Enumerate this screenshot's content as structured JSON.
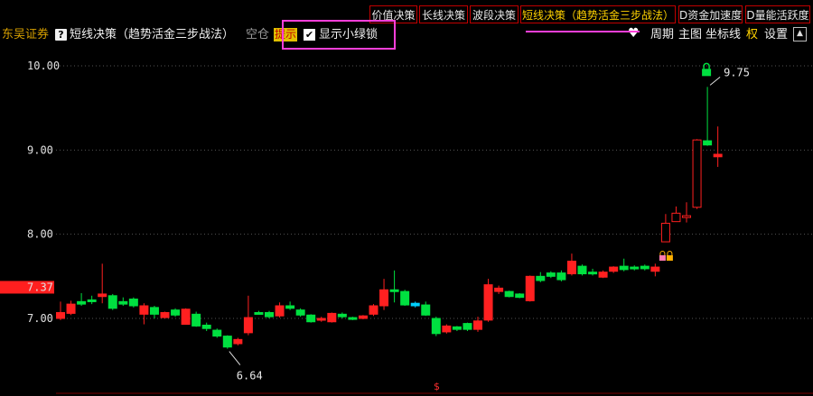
{
  "tabs": [
    {
      "label": "价值决策",
      "active": false
    },
    {
      "label": "长线决策",
      "active": false
    },
    {
      "label": "波段决策",
      "active": false
    },
    {
      "label": "短线决策（趋势活金三步战法）",
      "active": true
    },
    {
      "label": "D资金加速度",
      "active": false
    },
    {
      "label": "D量能活跃度",
      "active": false
    }
  ],
  "info": {
    "broker": "东吴证券",
    "help_icon": "?",
    "indicator": "短线决策（趋势活金三步战法）",
    "position": "空仓",
    "hint": "提示",
    "checkbox_mark": "✔",
    "checkbox_label": "显示小绿锁"
  },
  "toolbar": {
    "heart_icon": "♥",
    "period": "周期",
    "main_chart": "主图",
    "axis": "坐标线",
    "rights": "权",
    "settings": "设置",
    "up_icon": "▲"
  },
  "colors": {
    "up": "#ff2020",
    "down": "#00e040",
    "cyan": "#00d0ff",
    "current_price_bg": "#ff1f1f",
    "highlight": "#ff3fd9"
  },
  "chart_data": {
    "type": "candlestick",
    "ylim": [
      6.53,
      10.7
    ],
    "y_ticks": [
      "10.00",
      "9.00",
      "8.00",
      "7.00"
    ],
    "y_tick_values": [
      10.0,
      9.0,
      8.0,
      7.0
    ],
    "current_price_label": "7.37",
    "current_price": 7.37,
    "max_label": "9.75",
    "min_label": "6.64",
    "bottom_marker": "$",
    "lock_icons": [
      "lock-icon-green",
      "lock-icon-orange"
    ],
    "candles": [
      {
        "o": 7.0,
        "c": 7.07,
        "h": 7.2,
        "l": 6.98,
        "color": "up"
      },
      {
        "o": 7.06,
        "c": 7.17,
        "h": 7.21,
        "l": 7.04,
        "color": "up"
      },
      {
        "o": 7.2,
        "c": 7.17,
        "h": 7.3,
        "l": 7.15,
        "color": "down"
      },
      {
        "o": 7.22,
        "c": 7.21,
        "h": 7.27,
        "l": 7.17,
        "color": "down"
      },
      {
        "o": 7.26,
        "c": 7.29,
        "h": 7.65,
        "l": 7.18,
        "color": "up"
      },
      {
        "o": 7.27,
        "c": 7.12,
        "h": 7.29,
        "l": 7.1,
        "color": "down"
      },
      {
        "o": 7.2,
        "c": 7.17,
        "h": 7.25,
        "l": 7.15,
        "color": "down"
      },
      {
        "o": 7.23,
        "c": 7.15,
        "h": 7.25,
        "l": 7.13,
        "color": "down"
      },
      {
        "o": 7.05,
        "c": 7.15,
        "h": 7.18,
        "l": 6.93,
        "color": "up"
      },
      {
        "o": 7.13,
        "c": 7.05,
        "h": 7.15,
        "l": 7.0,
        "color": "down"
      },
      {
        "o": 7.01,
        "c": 7.07,
        "h": 7.08,
        "l": 7.0,
        "color": "up"
      },
      {
        "o": 7.1,
        "c": 7.04,
        "h": 7.12,
        "l": 7.02,
        "color": "down"
      },
      {
        "o": 6.93,
        "c": 7.11,
        "h": 7.12,
        "l": 6.93,
        "color": "up"
      },
      {
        "o": 7.05,
        "c": 6.91,
        "h": 7.08,
        "l": 6.9,
        "color": "down"
      },
      {
        "o": 6.92,
        "c": 6.88,
        "h": 6.95,
        "l": 6.85,
        "color": "down"
      },
      {
        "o": 6.86,
        "c": 6.79,
        "h": 6.88,
        "l": 6.77,
        "color": "down"
      },
      {
        "o": 6.79,
        "c": 6.66,
        "h": 6.8,
        "l": 6.64,
        "color": "down"
      },
      {
        "o": 6.7,
        "c": 6.75,
        "h": 6.77,
        "l": 6.68,
        "color": "up"
      },
      {
        "o": 6.83,
        "c": 7.01,
        "h": 7.27,
        "l": 6.8,
        "color": "up"
      },
      {
        "o": 7.07,
        "c": 7.07,
        "h": 7.09,
        "l": 7.05,
        "color": "down"
      },
      {
        "o": 7.07,
        "c": 7.02,
        "h": 7.09,
        "l": 7.0,
        "color": "down"
      },
      {
        "o": 7.03,
        "c": 7.15,
        "h": 7.19,
        "l": 7.01,
        "color": "up"
      },
      {
        "o": 7.15,
        "c": 7.12,
        "h": 7.2,
        "l": 7.1,
        "color": "down"
      },
      {
        "o": 7.1,
        "c": 7.04,
        "h": 7.12,
        "l": 7.02,
        "color": "down"
      },
      {
        "o": 7.04,
        "c": 6.96,
        "h": 7.05,
        "l": 6.95,
        "color": "down"
      },
      {
        "o": 6.98,
        "c": 7.0,
        "h": 7.02,
        "l": 6.96,
        "color": "up"
      },
      {
        "o": 6.96,
        "c": 7.06,
        "h": 7.07,
        "l": 6.95,
        "color": "up"
      },
      {
        "o": 7.05,
        "c": 7.02,
        "h": 7.07,
        "l": 7.0,
        "color": "down"
      },
      {
        "o": 7.01,
        "c": 7.0,
        "h": 7.02,
        "l": 6.98,
        "color": "down"
      },
      {
        "o": 7.0,
        "c": 7.03,
        "h": 7.04,
        "l": 6.99,
        "color": "up"
      },
      {
        "o": 7.05,
        "c": 7.15,
        "h": 7.17,
        "l": 7.03,
        "color": "up"
      },
      {
        "o": 7.15,
        "c": 7.34,
        "h": 7.47,
        "l": 7.1,
        "color": "up"
      },
      {
        "o": 7.34,
        "c": 7.32,
        "h": 7.57,
        "l": 7.19,
        "color": "down"
      },
      {
        "o": 7.32,
        "c": 7.16,
        "h": 7.34,
        "l": 7.15,
        "color": "down"
      },
      {
        "o": 7.18,
        "c": 7.15,
        "h": 7.2,
        "l": 7.13,
        "color": "cyan"
      },
      {
        "o": 7.16,
        "c": 7.04,
        "h": 7.2,
        "l": 7.03,
        "color": "down"
      },
      {
        "o": 7.0,
        "c": 6.82,
        "h": 7.02,
        "l": 6.79,
        "color": "down"
      },
      {
        "o": 6.84,
        "c": 6.91,
        "h": 6.93,
        "l": 6.82,
        "color": "up"
      },
      {
        "o": 6.9,
        "c": 6.87,
        "h": 6.91,
        "l": 6.85,
        "color": "down"
      },
      {
        "o": 6.87,
        "c": 6.94,
        "h": 6.95,
        "l": 6.85,
        "color": "down"
      },
      {
        "o": 6.87,
        "c": 6.97,
        "h": 7.02,
        "l": 6.84,
        "color": "up"
      },
      {
        "o": 6.98,
        "c": 7.4,
        "h": 7.47,
        "l": 6.96,
        "color": "up"
      },
      {
        "o": 7.32,
        "c": 7.36,
        "h": 7.39,
        "l": 7.29,
        "color": "up"
      },
      {
        "o": 7.32,
        "c": 7.26,
        "h": 7.33,
        "l": 7.25,
        "color": "down"
      },
      {
        "o": 7.25,
        "c": 7.29,
        "h": 7.3,
        "l": 7.24,
        "color": "down"
      },
      {
        "o": 7.21,
        "c": 7.5,
        "h": 7.51,
        "l": 7.2,
        "color": "up"
      },
      {
        "o": 7.5,
        "c": 7.45,
        "h": 7.55,
        "l": 7.43,
        "color": "down"
      },
      {
        "o": 7.54,
        "c": 7.5,
        "h": 7.56,
        "l": 7.48,
        "color": "down"
      },
      {
        "o": 7.54,
        "c": 7.46,
        "h": 7.57,
        "l": 7.44,
        "color": "down"
      },
      {
        "o": 7.53,
        "c": 7.68,
        "h": 7.77,
        "l": 7.51,
        "color": "up"
      },
      {
        "o": 7.62,
        "c": 7.53,
        "h": 7.64,
        "l": 7.51,
        "color": "down"
      },
      {
        "o": 7.54,
        "c": 7.55,
        "h": 7.59,
        "l": 7.51,
        "color": "down"
      },
      {
        "o": 7.49,
        "c": 7.55,
        "h": 7.57,
        "l": 7.48,
        "color": "up"
      },
      {
        "o": 7.56,
        "c": 7.61,
        "h": 7.62,
        "l": 7.54,
        "color": "up"
      },
      {
        "o": 7.62,
        "c": 7.58,
        "h": 7.71,
        "l": 7.56,
        "color": "down"
      },
      {
        "o": 7.59,
        "c": 7.61,
        "h": 7.63,
        "l": 7.57,
        "color": "down"
      },
      {
        "o": 7.59,
        "c": 7.62,
        "h": 7.64,
        "l": 7.57,
        "color": "down"
      },
      {
        "o": 7.56,
        "c": 7.61,
        "h": 7.65,
        "l": 7.5,
        "color": "up"
      },
      {
        "o": 8.13,
        "c": 7.91,
        "h": 8.24,
        "l": 7.95,
        "color": "up"
      },
      {
        "o": 8.15,
        "c": 8.25,
        "h": 8.33,
        "l": 8.15,
        "color": "up"
      },
      {
        "o": 8.21,
        "c": 8.22,
        "h": 8.38,
        "l": 8.14,
        "color": "up"
      },
      {
        "o": 8.32,
        "c": 9.12,
        "h": 9.13,
        "l": 8.3,
        "color": "up"
      },
      {
        "o": 9.06,
        "c": 9.11,
        "h": 9.75,
        "l": 9.05,
        "color": "down"
      },
      {
        "o": 8.92,
        "c": 8.95,
        "h": 9.28,
        "l": 8.8,
        "color": "up"
      }
    ]
  }
}
